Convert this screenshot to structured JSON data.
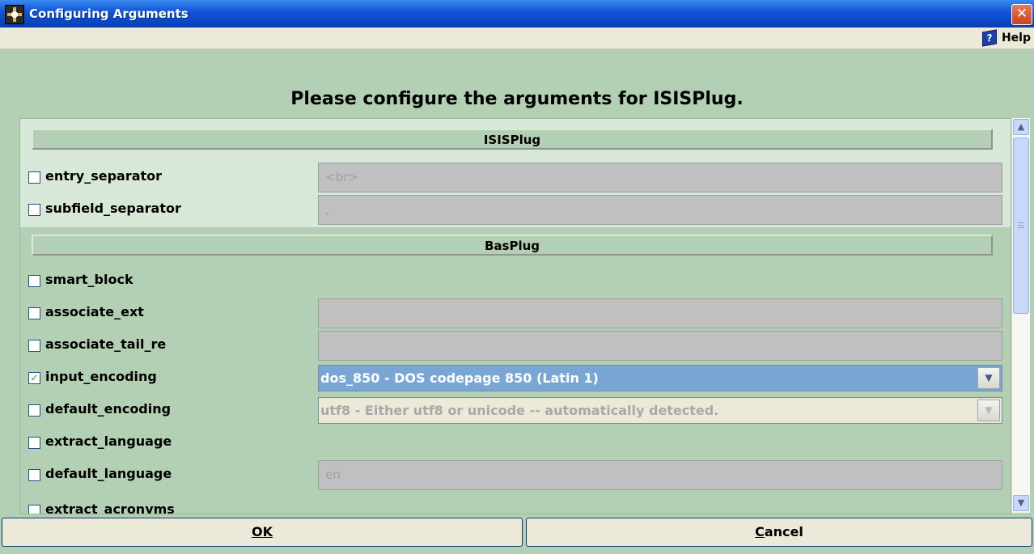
{
  "window": {
    "title": "Configuring Arguments",
    "close_glyph": "✕"
  },
  "menubar": {
    "help_label": "Help"
  },
  "heading": "Please configure the arguments for ISISPlug.",
  "sections": [
    {
      "title": "ISISPlug"
    },
    {
      "title": "BasPlug"
    }
  ],
  "arguments": [
    {
      "name": "entry_separator",
      "checked": false,
      "value": "<br>"
    },
    {
      "name": "subfield_separator",
      "checked": false,
      "value": ","
    },
    {
      "name": "smart_block",
      "checked": false
    },
    {
      "name": "associate_ext",
      "checked": false,
      "value": ""
    },
    {
      "name": "associate_tail_re",
      "checked": false,
      "value": ""
    },
    {
      "name": "input_encoding",
      "checked": true,
      "value": "dos_850 - DOS codepage 850 (Latin 1)"
    },
    {
      "name": "default_encoding",
      "checked": false,
      "value": "utf8 - Either utf8 or unicode -- automatically detected."
    },
    {
      "name": "extract_language",
      "checked": false
    },
    {
      "name": "default_language",
      "checked": false,
      "value": "en"
    },
    {
      "name": "extract_acronyms",
      "checked": false
    }
  ],
  "checkmark": "✓",
  "buttons": {
    "ok_label": "OK",
    "cancel_label": "Cancel"
  },
  "icons": {
    "help": "help-book-icon",
    "app": "compass-icon",
    "dropdown": "chevron-down-icon"
  }
}
